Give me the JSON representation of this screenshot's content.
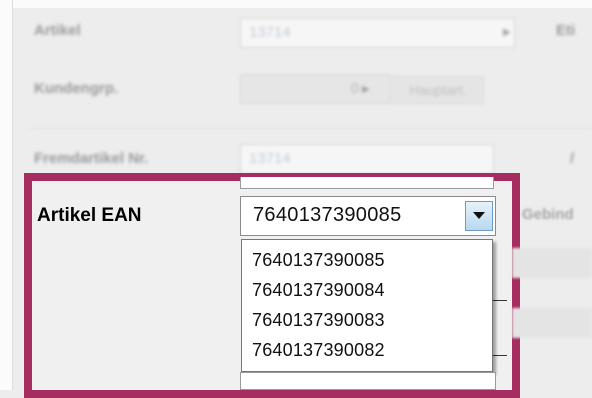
{
  "background_form": {
    "artikel_label": "Artikel",
    "artikel_value": "13714",
    "right_label_partial": "Eti",
    "kundengrp_label": "Kundengrp.",
    "kundengrp_value": "0",
    "haupt_button": "Hauptart.",
    "fremdartikel_label": "Fremdartikel Nr.",
    "fremdartikel_value": "13714",
    "gebinde_partial": "Gebind",
    "slash_partial": "/"
  },
  "ean": {
    "label": "Artikel EAN",
    "selected": "7640137390085",
    "options": [
      "7640137390085",
      "7640137390084",
      "7640137390083",
      "7640137390082"
    ]
  },
  "colors": {
    "highlight_border": "#a52d5f",
    "dropdown_button": "#b9d8ef"
  },
  "icons": {
    "dropdown_arrow": "chevron-down-icon",
    "field_arrow": "play-right-icon"
  }
}
